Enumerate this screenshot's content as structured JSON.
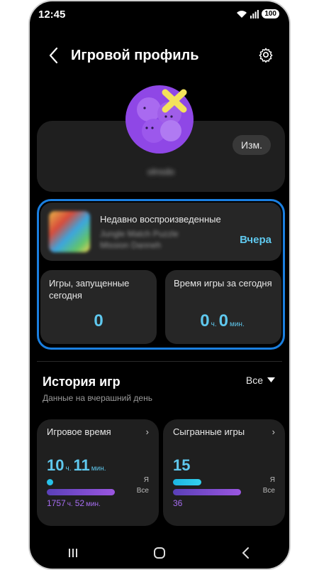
{
  "status": {
    "time": "12:45",
    "battery": "100"
  },
  "header": {
    "title": "Игровой профиль"
  },
  "profile": {
    "edit_label": "Изм.",
    "nickname": "olnsdo"
  },
  "recent": {
    "label": "Недавно воспроизведенные",
    "game_line1": "Jungle Match Puzzle",
    "game_line2": "Mission Danneh",
    "when": "Вчера"
  },
  "stats": {
    "games_today": {
      "label": "Игры, запущенные сегодня",
      "value": "0"
    },
    "time_today": {
      "label": "Время игры за сегодня",
      "hours": "0",
      "hours_unit": "ч.",
      "minutes": "0",
      "minutes_unit": "мин."
    }
  },
  "history": {
    "title": "История игр",
    "filter": "Все",
    "subtitle": "Данные на вчерашний день",
    "play_time": {
      "title": "Игровое время",
      "hours": "10",
      "hours_unit": "ч.",
      "minutes": "11",
      "minutes_unit": "мин.",
      "bar_me_label": "Я",
      "bar_all_label": "Все",
      "total_hours": "1757",
      "total_hours_unit": "ч.",
      "total_minutes": "52",
      "total_minutes_unit": "мин."
    },
    "played_games": {
      "title": "Сыгранные игры",
      "value": "15",
      "bar_me_label": "Я",
      "bar_all_label": "Все",
      "total": "36"
    }
  },
  "colors": {
    "accent": "#5fc8ee",
    "purple": "#a66df0",
    "highlight": "#1a7fe0"
  }
}
